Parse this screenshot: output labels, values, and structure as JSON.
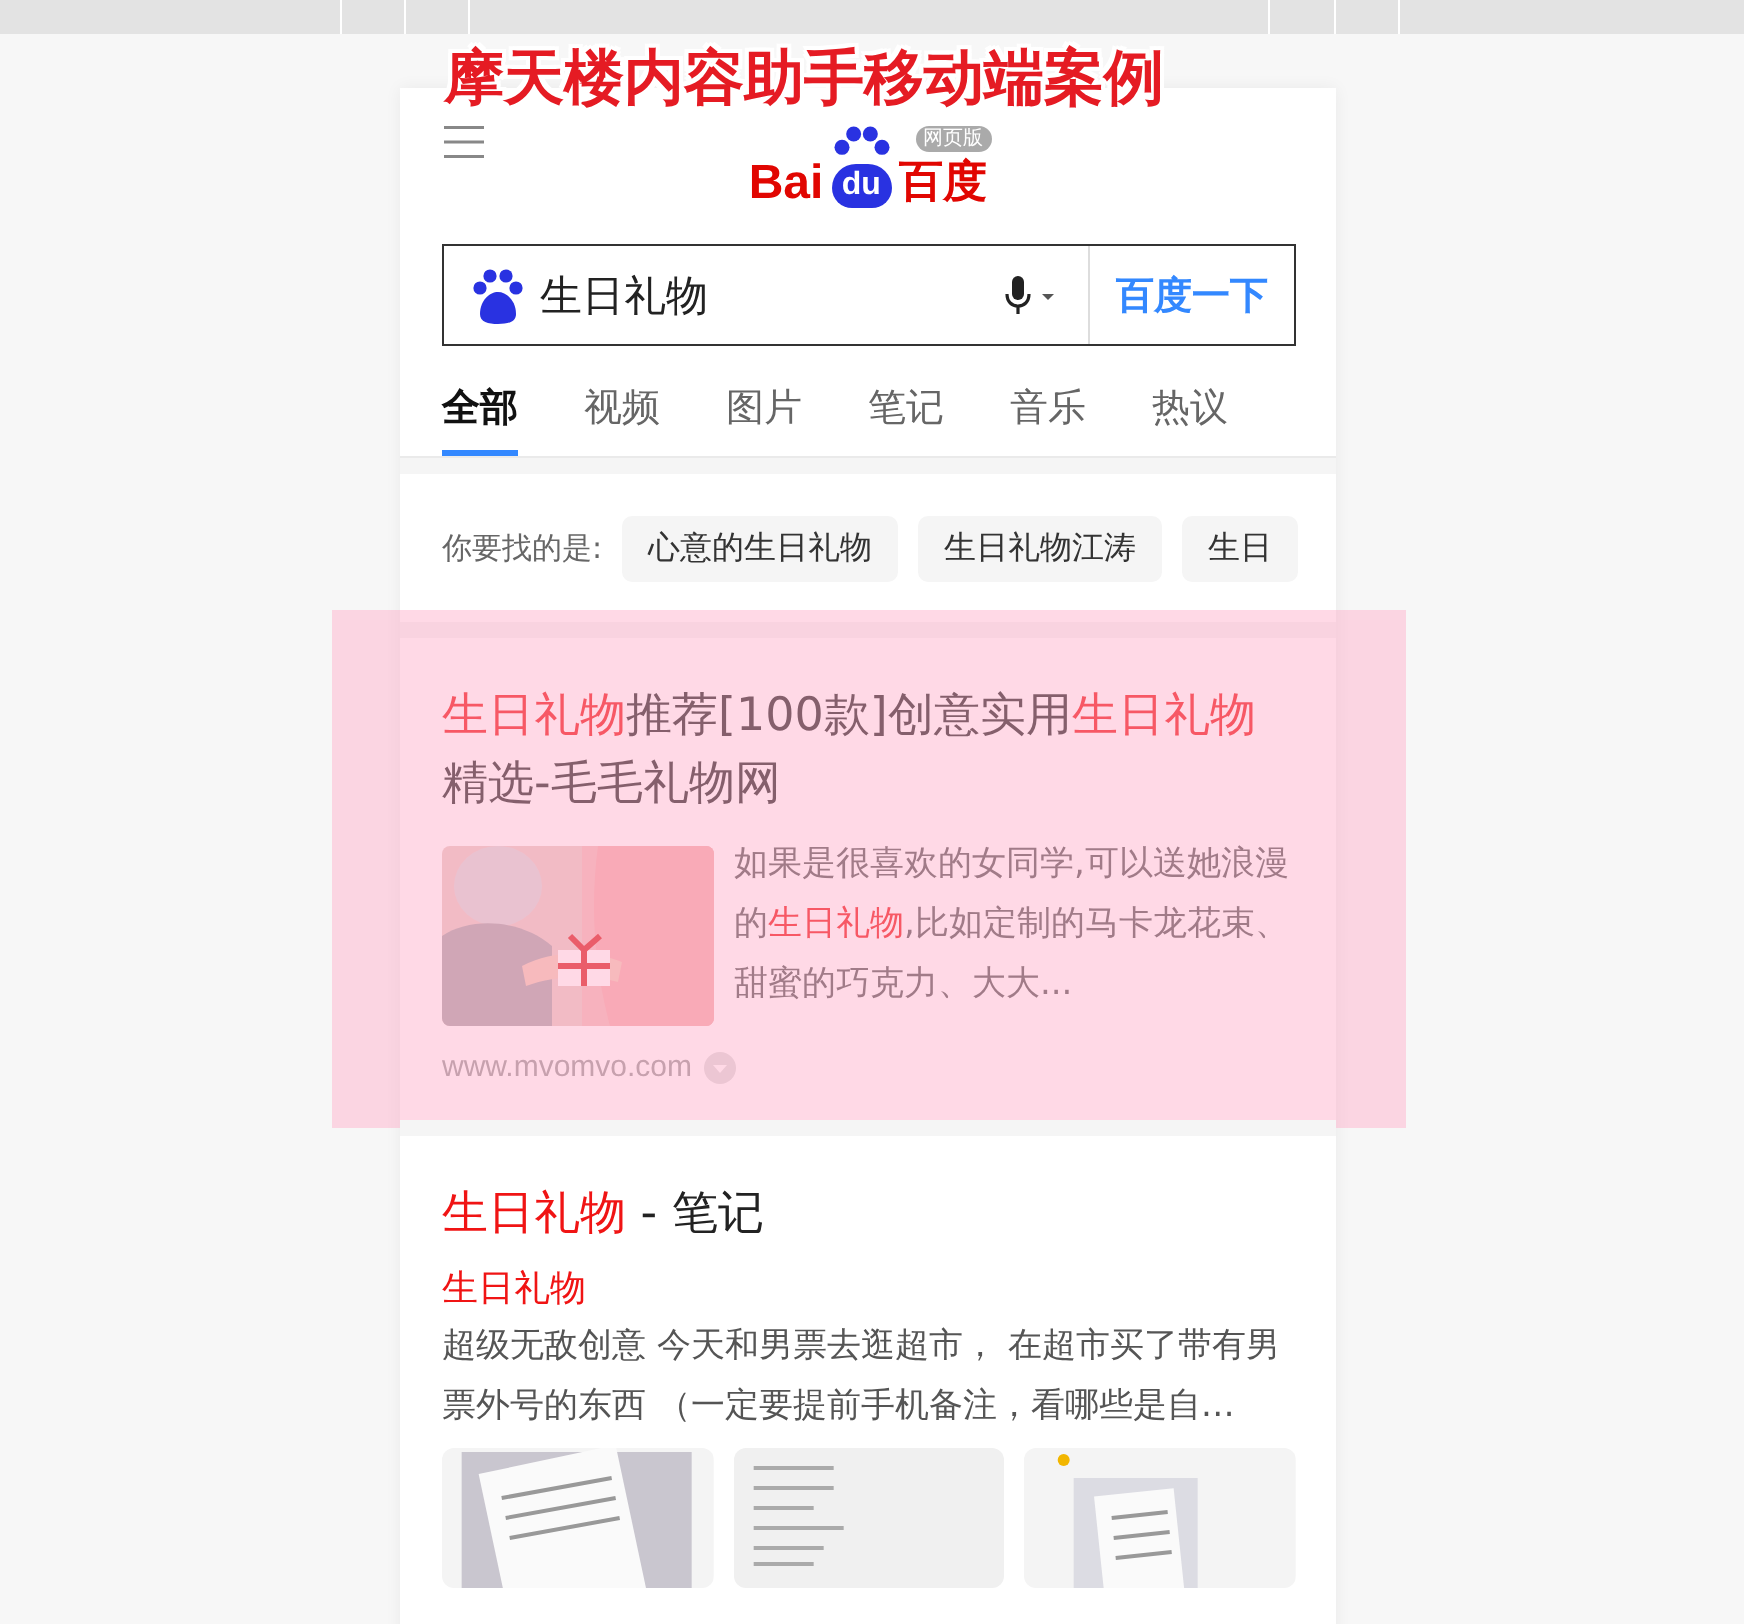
{
  "banner_title": "摩天楼内容助手移动端案例",
  "header": {
    "logo_text": "Bai",
    "logo_du": "du",
    "logo_cn": "百度",
    "logo_badge": "网页版"
  },
  "search": {
    "value": "生日礼物",
    "button": "百度一下"
  },
  "tabs": [
    {
      "label": "全部",
      "selected": true
    },
    {
      "label": "视频",
      "selected": false
    },
    {
      "label": "图片",
      "selected": false
    },
    {
      "label": "笔记",
      "selected": false
    },
    {
      "label": "音乐",
      "selected": false
    },
    {
      "label": "热议",
      "selected": false
    }
  ],
  "suggestions": {
    "label": "你要找的是:",
    "items": [
      "心意的生日礼物",
      "生日礼物江涛",
      "生日"
    ]
  },
  "results": [
    {
      "kind": "article",
      "highlighted": true,
      "title": [
        {
          "text": "生日礼物",
          "highlight": true
        },
        {
          "text": "推荐[100款]创意实用",
          "highlight": false
        },
        {
          "text": "生日礼物",
          "highlight": true
        },
        {
          "text": "精选-毛毛礼物网",
          "highlight": false
        }
      ],
      "snippet": [
        {
          "text": "如果是很喜欢的女同学,可以送她浪漫的",
          "highlight": false
        },
        {
          "text": "生日礼物",
          "highlight": true
        },
        {
          "text": ",比如定制的马卡龙花束、甜蜜的巧克力、大大...",
          "highlight": false
        }
      ],
      "url": "www.mvomvo.com"
    },
    {
      "kind": "notes",
      "highlighted": false,
      "title": [
        {
          "text": "生日礼物",
          "highlight": true
        },
        {
          "text": " - 笔记",
          "highlight": false
        }
      ],
      "subtitle": "生日礼物",
      "snippet": [
        {
          "text": "超级无敌创意 今天和男票去逛超市， 在超市买了带有男票外号的东西 （一定要提前手机备注，看哪些是自…",
          "highlight": false
        }
      ],
      "images": [
        {
          "kind": "picture"
        },
        {
          "kind": "picture"
        },
        {
          "kind": "picture"
        }
      ]
    }
  ]
}
